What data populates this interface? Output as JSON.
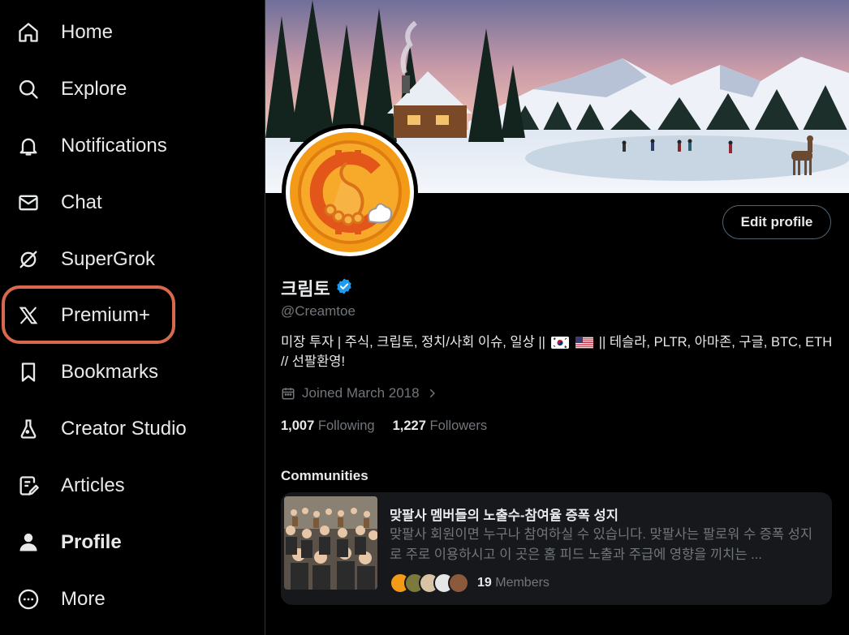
{
  "sidebar": {
    "items": [
      {
        "label": "Home",
        "icon": "home-icon"
      },
      {
        "label": "Explore",
        "icon": "search-icon"
      },
      {
        "label": "Notifications",
        "icon": "bell-icon"
      },
      {
        "label": "Chat",
        "icon": "mail-icon"
      },
      {
        "label": "SuperGrok",
        "icon": "grok-icon"
      },
      {
        "label": "Premium+",
        "icon": "x-logo-icon"
      },
      {
        "label": "Bookmarks",
        "icon": "bookmark-icon"
      },
      {
        "label": "Creator Studio",
        "icon": "flask-icon"
      },
      {
        "label": "Articles",
        "icon": "article-edit-icon"
      },
      {
        "label": "Profile",
        "icon": "person-icon"
      },
      {
        "label": "More",
        "icon": "more-circle-icon"
      }
    ],
    "highlight_color": "#d9694e"
  },
  "profile": {
    "edit_label": "Edit profile",
    "name": "크림토",
    "handle": "@Creamtoe",
    "bio_part1": "미장 투자 | 주식, 크립토, 정치/사회 이슈, 일상 ||",
    "bio_part2": "|| 테슬라, PLTR, 아마존, 구글, BTC, ETH // 선팔환영!",
    "joined": "Joined March 2018",
    "following_count": "1,007",
    "following_label": "Following",
    "followers_count": "1,227",
    "followers_label": "Followers"
  },
  "communities": {
    "title": "Communities",
    "card": {
      "name": "맞팔사 멤버들의 노출수-참여율 증폭 성지",
      "description": "맞팔사 회원이면 누구나 참여하실 수 있습니다. 맞팔사는 팔로워 수 증폭 성지로 주로 이용하시고 이 곳은 홈 피드 노출과 주급에 영향을 끼치는 ...",
      "members_count": "19",
      "members_label": "Members"
    }
  },
  "colors": {
    "verified": "#1d9bf0",
    "muted_text": "#71767b",
    "card_bg": "#16181c"
  }
}
